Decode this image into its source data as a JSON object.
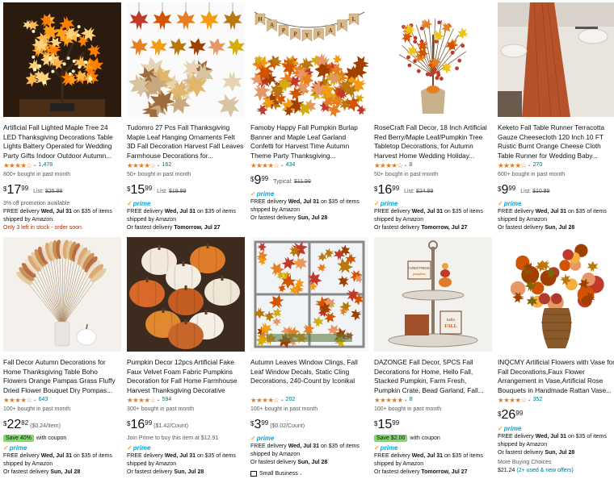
{
  "products": [
    {
      "title": "Artificial Fall Lighted Maple Tree 24 LED Thanksgiving Decorations Table Lights Battery Operated for Wedding Party Gifts Indoor Outdoor Autumn...",
      "stars": "★★★★☆",
      "rating_value": 4.4,
      "reviews": "1,478",
      "bought": "800+ bought in past month",
      "price": {
        "symbol": "$",
        "whole": "17",
        "fraction": "99"
      },
      "list_label": "List:",
      "list_price": "$25.99",
      "promo": "3% off promotion available",
      "delivery_prefix": "FREE delivery ",
      "delivery_date": "Wed, Jul 31",
      "delivery_suffix": " on $35 of items shipped by Amazon.",
      "stock": "Only 3 left in stock - order soon."
    },
    {
      "title": "Tudomro 27 Pcs Fall Thanksgiving Maple Leaf Hanging Ornaments Felt 3D Fall Decoration Harvest Fall Leaves Farmhouse Decorations for...",
      "stars": "★★★★☆",
      "rating_value": 4.5,
      "reviews": "162",
      "bought": "50+ bought in past month",
      "price": {
        "symbol": "$",
        "whole": "15",
        "fraction": "99"
      },
      "list_label": "List:",
      "list_price": "$19.99",
      "prime": "prime",
      "delivery_prefix": "FREE delivery ",
      "delivery_date": "Wed, Jul 31",
      "delivery_suffix": " on $35 of items shipped by Amazon",
      "fastest_prefix": "Or fastest delivery ",
      "fastest_date": "Tomorrow, Jul 27"
    },
    {
      "title": "Famoby Happy Fall Pumpkin Burlap Banner and Maple Leaf Garland Confetti for Harvest Time Autumn Theme Party Thanksgiving...",
      "stars": "★★★★☆",
      "rating_value": 4.5,
      "reviews": "434",
      "price": {
        "symbol": "$",
        "whole": "9",
        "fraction": "99"
      },
      "list_label": "Typical:",
      "list_price": "$11.99",
      "prime": "prime",
      "delivery_prefix": "FREE delivery ",
      "delivery_date": "Wed, Jul 31",
      "delivery_suffix": " on $35 of items shipped by Amazon",
      "fastest_prefix": "Or fastest delivery ",
      "fastest_date": "Sun, Jul 28"
    },
    {
      "title": "RoseCraft Fall Decor, 18 Inch Artificial Red Berry/Maple Leaf/Pumpkin Tree Tabletop Decorations, for Autumn Harvest Home Wedding Holiday...",
      "stars": "★★★★☆",
      "rating_value": 4.4,
      "reviews": "8",
      "bought": "50+ bought in past month",
      "price": {
        "symbol": "$",
        "whole": "16",
        "fraction": "99"
      },
      "list_label": "List:",
      "list_price": "$24.99",
      "prime": "prime",
      "delivery_prefix": "FREE delivery ",
      "delivery_date": "Wed, Jul 31",
      "delivery_suffix": " on $35 of items shipped by Amazon",
      "fastest_prefix": "Or fastest delivery ",
      "fastest_date": "Tomorrow, Jul 27"
    },
    {
      "title": "Keketo Fall Table Runner Terracotta Gauze Cheesecloth 120 Inch 10 FT Rustic Burnt Orange Cheese Cloth Table Runner for Wedding Baby...",
      "stars": "★★★★☆",
      "rating_value": 4.4,
      "reviews": "270",
      "bought": "600+ bought in past month",
      "price": {
        "symbol": "$",
        "whole": "9",
        "fraction": "99"
      },
      "list_label": "List:",
      "list_price": "$10.99",
      "prime": "prime",
      "delivery_prefix": "FREE delivery ",
      "delivery_date": "Wed, Jul 31",
      "delivery_suffix": " on $35 of items shipped by Amazon",
      "fastest_prefix": "Or fastest delivery ",
      "fastest_date": "Sun, Jul 28"
    },
    {
      "title": "Fall Decor Autumn Decorations for Home Thanksgiving Table Boho Flowers Orange Pampas Grass Fluffy Dried Flower Bouquet Dry Pompas...",
      "stars": "★★★★☆",
      "rating_value": 4.4,
      "reviews": "643",
      "bought": "100+ bought in past month",
      "price": {
        "symbol": "$",
        "whole": "22",
        "fraction": "82"
      },
      "unit_price": "($0.24/Item)",
      "save_badge": "Save 40%",
      "save_text": "with coupon",
      "prime": "prime",
      "delivery_prefix": "FREE delivery ",
      "delivery_date": "Wed, Jul 31",
      "delivery_suffix": " on $35 of items shipped by Amazon",
      "fastest_prefix": "Or fastest delivery ",
      "fastest_date": "Sun, Jul 28"
    },
    {
      "title": "Pumpkin Decor 12pcs Artificial Fake Faux Velvet Foam Fabric Pumpkins Decoration for Fall Home Farmhouse Harvest Thanksgiving Decorative",
      "stars": "★★★★☆",
      "rating_value": 4.5,
      "reviews": "594",
      "bought": "300+ bought in past month",
      "price": {
        "symbol": "$",
        "whole": "16",
        "fraction": "99"
      },
      "unit_price": "($1.42/Count)",
      "join": "Join Prime to buy this item at $12.91",
      "prime": "prime",
      "delivery_prefix": "FREE delivery ",
      "delivery_date": "Wed, Jul 31",
      "delivery_suffix": " on $35 of items shipped by Amazon",
      "fastest_prefix": "Or fastest delivery ",
      "fastest_date": "Sun, Jul 28"
    },
    {
      "title": "Autumn Leaves Window Clings, Fall Leaf Window Decals, Static Cling Decorations, 240-Count by Iconikal",
      "stars": "★★★★☆",
      "rating_value": 4.6,
      "reviews": "202",
      "bought": "100+ bought in past month",
      "price": {
        "symbol": "$",
        "whole": "3",
        "fraction": "99"
      },
      "unit_price": "($0.02/Count)",
      "prime": "prime",
      "delivery_prefix": "FREE delivery ",
      "delivery_date": "Wed, Jul 31",
      "delivery_suffix": " on $35 of items shipped by Amazon",
      "fastest_prefix": "Or fastest delivery ",
      "fastest_date": "Sun, Jul 28",
      "small_business": "Small Business"
    },
    {
      "title": "DAZONGE Fall Decor, 5PCS Fall Decorations for Home, Hello Fall, Stacked Pumpkin, Farm Fresh, Pumpkin Crate, Bead Garland, Fall...",
      "stars": "★★★★★",
      "rating_value": 4.8,
      "reviews": "8",
      "bought": "100+ bought in past month",
      "price": {
        "symbol": "$",
        "whole": "15",
        "fraction": "99"
      },
      "save_badge": "Save $2.00",
      "save_text": "with coupon",
      "prime": "prime",
      "delivery_prefix": "FREE delivery ",
      "delivery_date": "Wed, Jul 31",
      "delivery_suffix": " on $35 of items shipped by Amazon",
      "fastest_prefix": "Or fastest delivery ",
      "fastest_date": "Tomorrow, Jul 27"
    },
    {
      "title": "INQCMY Artificial Flowers with Vase for Fall Decorations,Faux Flower Arrangement in Vase,Artificial Rose Bouquets in Handmade Rattan Vase...",
      "stars": "★★★★☆",
      "rating_value": 4.4,
      "reviews": "352",
      "price": {
        "symbol": "$",
        "whole": "26",
        "fraction": "99"
      },
      "prime": "prime",
      "delivery_prefix": "FREE delivery ",
      "delivery_date": "Wed, Jul 31",
      "delivery_suffix": " on $35 of items shipped by Amazon",
      "fastest_prefix": "Or fastest delivery ",
      "fastest_date": "Sun, Jul 28",
      "more_label": "More Buying Choices",
      "more_price": "$21.24",
      "more_offers": "(2+ used & new offers)"
    }
  ],
  "colors": {
    "star": "#de7921",
    "link": "#007185",
    "prime": "#00a8e1",
    "save_badge": "#7fda69",
    "stock_warning": "#b12704"
  }
}
